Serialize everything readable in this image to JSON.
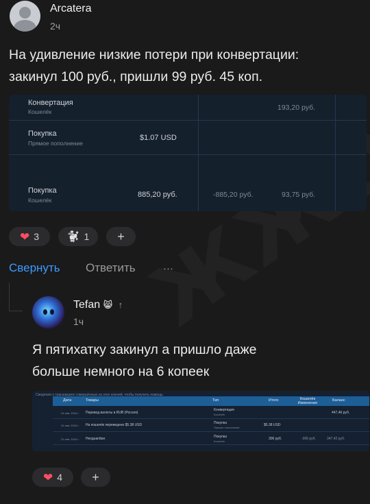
{
  "post": {
    "author": "Arcatera",
    "time": "2ч",
    "text_line1": "На удивление низкие потери при конвертации:",
    "text_line2": "закинул 100 руб., пришли 99 руб. 45 коп."
  },
  "statement": {
    "rows": [
      {
        "title": "Конвертация",
        "sub": "Кошелёк",
        "amount": "",
        "change": "",
        "balance": "193,20 руб."
      },
      {
        "title": "Покупка",
        "sub": "Прямое пополнение",
        "amount": "$1.07 USD",
        "change": "",
        "balance": ""
      },
      {
        "title": "Покупка",
        "sub": "Кошелёк",
        "amount": "885,20 руб.",
        "change": "-885,20 руб.",
        "balance": "93,75 руб."
      }
    ]
  },
  "post_reactions": {
    "heart_count": "3",
    "second_count": "1",
    "add_label": "+"
  },
  "actions": {
    "collapse": "Свернуть",
    "reply": "Ответить",
    "more": "···"
  },
  "reply": {
    "author": "Tefan",
    "author_emoji": "😸",
    "arrow": "↑",
    "time": "1ч",
    "text_line1": "Я пятихатку закинул а пришло даже",
    "text_line2": "больше немного на 6 копеек"
  },
  "reply_table": {
    "top_note": "Сведения о транзакциях совершённых из этих ключей, чтобы получить помощь",
    "headers": [
      "Дата",
      "Товары",
      "Тип",
      "Итого",
      "Кошелёк Изменение",
      "Баланс"
    ],
    "rows": [
      {
        "date": "24 янв. 2024 г.",
        "item": "Перевод валюты в RUB (Россия)",
        "type": "Конвертация",
        "type_sub": "Кошелёк",
        "total": "",
        "change": "",
        "balance": "447,46 руб."
      },
      {
        "date": "24 янв. 2024 г.",
        "item": "На кошелёк переведено $5.38 USD",
        "type": "Покупка",
        "type_sub": "Прямое пополнение",
        "total": "$5.38 USD",
        "change": "",
        "balance": ""
      },
      {
        "date": "21 янв. 2024 г.",
        "item": "Hexguardian",
        "type": "Покупка",
        "type_sub": "Кошелёк",
        "total": "306 руб.",
        "change": "-306 руб.",
        "balance": "347,42 руб."
      }
    ]
  },
  "reply_reactions": {
    "heart_count": "4",
    "add_label": "+"
  },
  "colors": {
    "background": "#1a1a1b",
    "link_blue": "#3d9bff",
    "heart": "#ff4d61",
    "table_header": "#1d5e97"
  }
}
